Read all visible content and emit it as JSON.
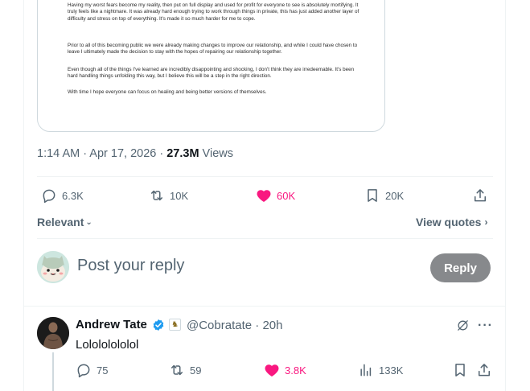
{
  "statement": {
    "paragraphs": [
      "Having my worst fears become my reality, then put on full display and used for profit for everyone to see is absolutely mortifying. It truly feels like a nightmare. It was already hard enough trying to work through things in private, this has just added another layer of difficulty and stress on top of everything. It's made it so much harder for me to cope.",
      "Prior to all of this becoming public we were already making changes to improve our relationship, and while I could have chosen to leave I ultimately made the decision to stay with the hopes of repairing our relationship together.",
      "Even though all of the things I've learned are incredibly disappointing and shocking, I don't think they are irredeemable. It's been hard handling things unfolding this way, but I believe this will be a step in the right direction.",
      "With time I hope everyone can focus on healing and being better versions of themselves."
    ]
  },
  "post": {
    "timestamp": "1:14 AM · Apr 17, 2026 · ",
    "views_count": "27.3M",
    "views_label": " Views"
  },
  "actions": {
    "replies": "6.3K",
    "reposts": "10K",
    "likes": "60K",
    "bookmarks": "20K"
  },
  "sort": {
    "label": "Relevant",
    "view_quotes": "View quotes"
  },
  "composer": {
    "placeholder": "Post your reply",
    "button": "Reply"
  },
  "reply": {
    "name": "Andrew Tate",
    "handle": "@Cobratate",
    "time": "20h",
    "separator": " · ",
    "text": "Lolololololol",
    "replies": "75",
    "reposts": "59",
    "likes": "3.8K",
    "views": "133K"
  },
  "colors": {
    "like": "#f91880",
    "verified": "#1d9bf0",
    "muted": "#536471",
    "reply_button": "#87898c"
  }
}
